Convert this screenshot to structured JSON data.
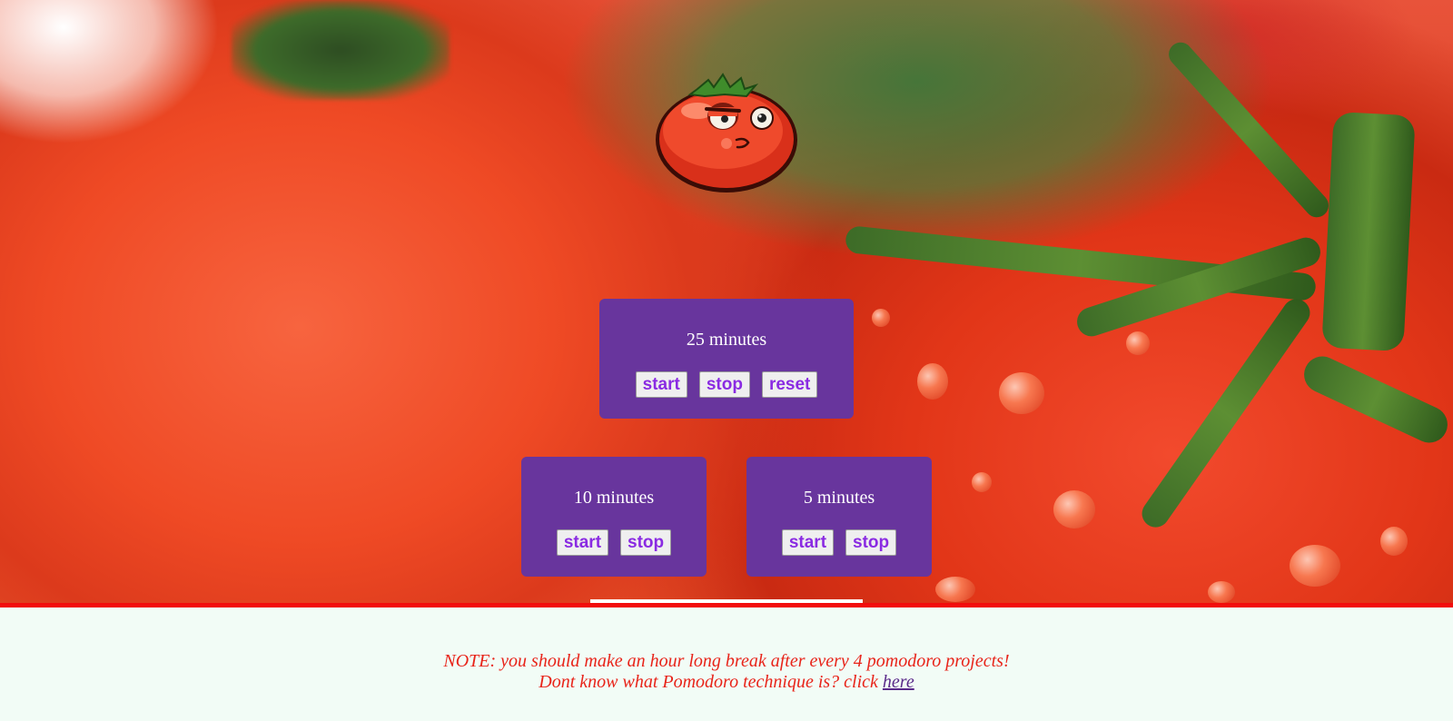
{
  "timers": {
    "main": {
      "title": "25 minutes",
      "start_label": "start",
      "stop_label": "stop",
      "reset_label": "reset"
    },
    "short": {
      "title": "10 minutes",
      "start_label": "start",
      "stop_label": "stop"
    },
    "shorter": {
      "title": "5 minutes",
      "start_label": "start",
      "stop_label": "stop"
    }
  },
  "footer": {
    "note_line1": "NOTE: you should make an hour long break after every 4 pomodoro projects!",
    "note_line2_prefix": "Dont know what Pomodoro technique is? click ",
    "link_label": "here"
  },
  "colors": {
    "box_background": "#68359d",
    "button_text": "#8a2be2",
    "note_text": "#e8241a",
    "divider": "#f20c0c",
    "footer_background": "#f2fcf6"
  },
  "icons": {
    "mascot": "tomato-mascot-icon"
  }
}
